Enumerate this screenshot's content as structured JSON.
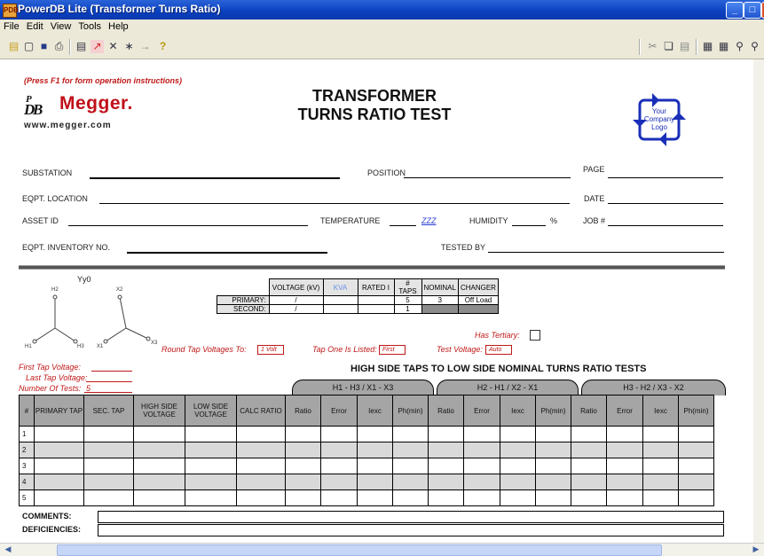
{
  "window": {
    "title": "PowerDB Lite (Transformer Turns Ratio)",
    "app_icon": "PDB"
  },
  "menu": [
    "File",
    "Edit",
    "View",
    "Tools",
    "Help"
  ],
  "toolbar_icons": [
    "open-icon",
    "new-icon",
    "save-icon",
    "print-icon",
    "preview-icon",
    "chart-icon",
    "delete-icon",
    "insert-icon",
    "arrow-icon",
    "help-icon"
  ],
  "form": {
    "instruction": "(Press F1 for form operation instructions)",
    "brand": "Megger.",
    "brand_mark": "PDB",
    "url": "www.megger.com",
    "title_line1": "TRANSFORMER",
    "title_line2": "TURNS RATIO TEST",
    "company_logo": [
      "Your",
      "Company",
      "Logo"
    ],
    "fields": {
      "substation": "SUBSTATION",
      "position": "POSITION",
      "page": "PAGE",
      "eqpt_location": "EQPT. LOCATION",
      "date": "DATE",
      "asset_id": "ASSET ID",
      "temperature": "TEMPERATURE",
      "temperature_value": "ZZZ",
      "humidity": "HUMIDITY",
      "humidity_unit": "%",
      "job": "JOB #",
      "inventory": "EQPT. INVENTORY NO.",
      "tested_by": "TESTED BY"
    },
    "vector_group": "Yy0",
    "spec_table": {
      "headers": [
        "VOLTAGE (kV)",
        "KVA",
        "RATED I",
        "# TAPS",
        "NOMINAL",
        "CHANGER"
      ],
      "primary_label": "PRIMARY:",
      "primary": [
        "/",
        "",
        "",
        "5",
        "3",
        "Off Load"
      ],
      "second_label": "SECOND:",
      "second": [
        "/",
        "",
        "",
        "1",
        "",
        ""
      ]
    },
    "has_tertiary": "Has Tertiary:",
    "round_tap_label": "Round Tap Voltages To:",
    "round_tap_value": "1 Volt",
    "tap_one_label": "Tap One Is Listed:",
    "tap_one_value": "First",
    "test_voltage_label": "Test Voltage:",
    "test_voltage_value": "Auto",
    "first_tap_label": "First Tap Voltage:",
    "last_tap_label": "Last Tap Voltage:",
    "num_tests_label": "Number Of Tests:",
    "num_tests_value": "5",
    "section_title": "HIGH SIDE TAPS TO LOW SIDE NOMINAL TURNS RATIO TESTS",
    "groups": [
      "H1 - H3 / X1 - X3",
      "H2 - H1 / X2 - X1",
      "H3 - H2 / X3 - X2"
    ],
    "grid_headers": [
      "#",
      "PRIMARY TAP",
      "SEC. TAP",
      "HIGH SIDE VOLTAGE",
      "LOW SIDE VOLTAGE",
      "CALC RATIO",
      "Ratio",
      "Error",
      "Iexc",
      "Ph(min)",
      "Ratio",
      "Error",
      "Iexc",
      "Ph(min)",
      "Ratio",
      "Error",
      "Iexc",
      "Ph(min)"
    ],
    "rows": [
      "1",
      "2",
      "3",
      "4",
      "5"
    ],
    "comments": "COMMENTS:",
    "deficiencies": "DEFICIENCIES:"
  }
}
